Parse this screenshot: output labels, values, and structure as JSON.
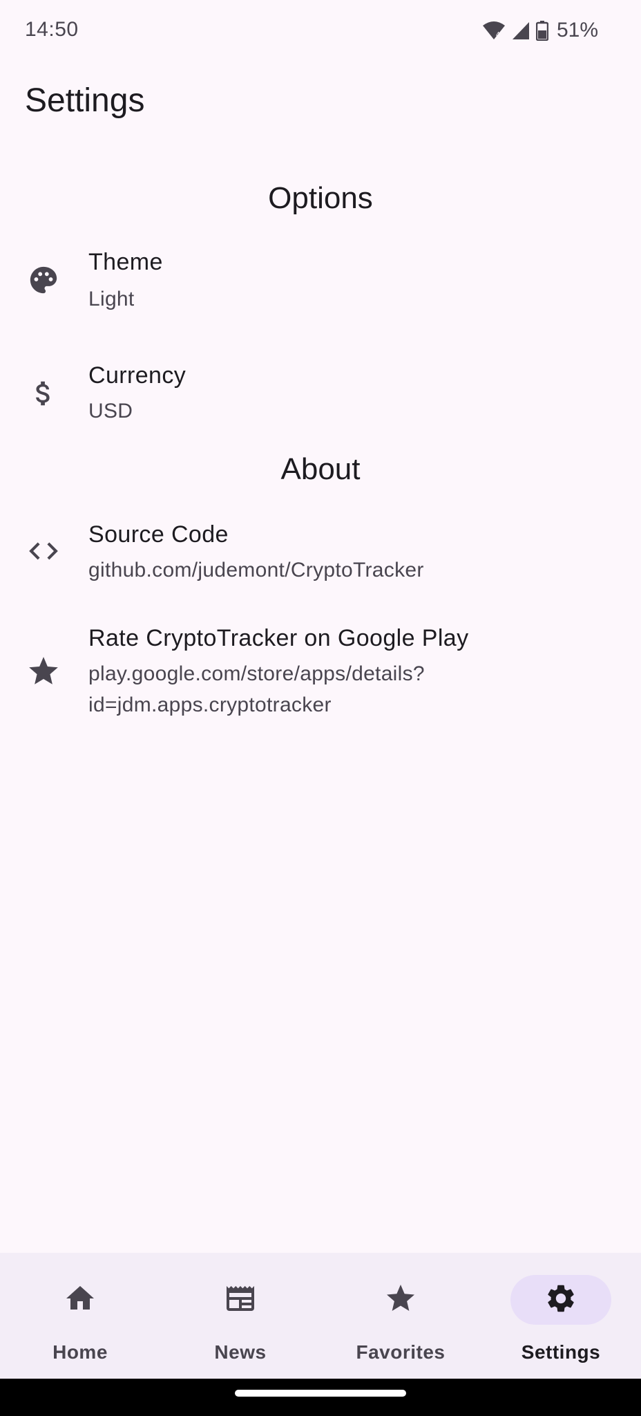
{
  "status_bar": {
    "time": "14:50",
    "battery": "51%",
    "icons": [
      "wifi-icon",
      "cell-signal-icon",
      "battery-icon"
    ]
  },
  "app": {
    "title": "Settings"
  },
  "sections": [
    {
      "header": "Options",
      "items": [
        {
          "icon": "palette-icon",
          "title": "Theme",
          "subtitle": "Light"
        },
        {
          "icon": "dollar-icon",
          "title": "Currency",
          "subtitle": "USD"
        }
      ]
    },
    {
      "header": "About",
      "items": [
        {
          "icon": "code-icon",
          "title": "Source Code",
          "subtitle": "github.com/judemont/CryptoTracker"
        },
        {
          "icon": "star-icon",
          "title": "Rate CryptoTracker on Google Play",
          "subtitle_line1": "play.google.com/store/apps/details?",
          "subtitle_line2": "id=jdm.apps.cryptotracker"
        }
      ]
    }
  ],
  "bottom_nav": {
    "items": [
      {
        "icon": "home-icon",
        "label": "Home",
        "active": false
      },
      {
        "icon": "news-icon",
        "label": "News",
        "active": false
      },
      {
        "icon": "star-icon",
        "label": "Favorites",
        "active": false
      },
      {
        "icon": "gear-icon",
        "label": "Settings",
        "active": true
      }
    ]
  },
  "colors": {
    "background": "#fdf7fc",
    "nav_background": "#f3edf7",
    "active_indicator": "#e8def8",
    "text_primary": "#1d1b20",
    "text_secondary": "#49454f"
  }
}
